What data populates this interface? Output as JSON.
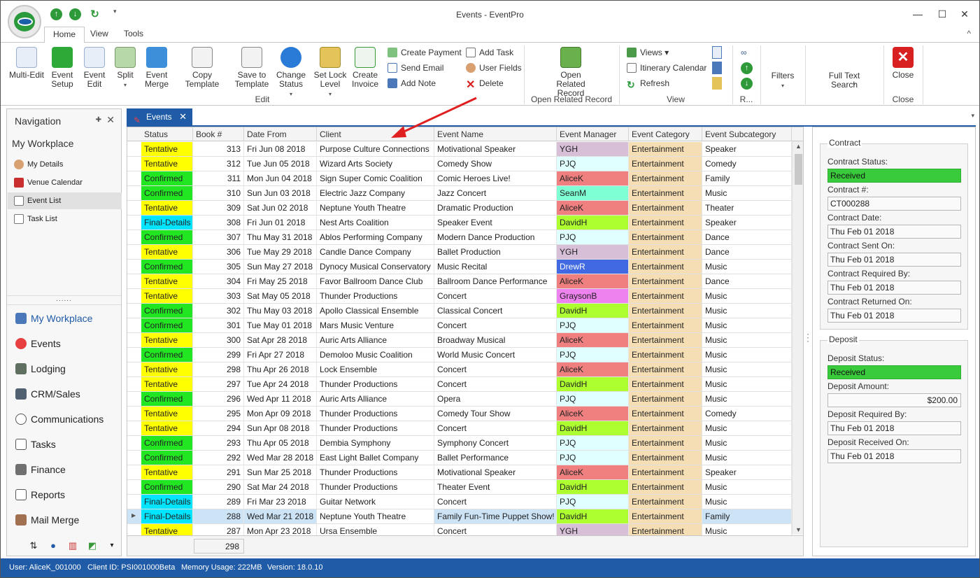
{
  "window": {
    "title": "Events - EventPro"
  },
  "ribbon": {
    "tabs": [
      "Home",
      "View",
      "Tools"
    ],
    "edit_group": {
      "buttons": [
        "Multi-Edit",
        "Event Setup",
        "Event Edit",
        "Split",
        "Event Merge",
        "Copy Template",
        "Save to Template",
        "Change Status",
        "Set Lock Level",
        "Create Invoice"
      ],
      "small": [
        "Create Payment",
        "Send Email",
        "Add Note",
        "Add Task",
        "User Fields",
        "Delete"
      ],
      "label": "Edit"
    },
    "open_related": {
      "button": "Open Related Record",
      "label": "Open Related Record"
    },
    "view_group": {
      "small": [
        "Views",
        "Itinerary Calendar",
        "Refresh"
      ],
      "label": "View"
    },
    "r_label": "R...",
    "filters": "Filters",
    "full_text_search": "Full Text Search",
    "close": {
      "button": "Close",
      "label": "Close"
    }
  },
  "navigation": {
    "title": "Navigation",
    "workplace": "My Workplace",
    "sub_items": [
      "My Details",
      "Venue Calendar",
      "Event List",
      "Task List"
    ],
    "grip": "......",
    "main_items": [
      "My Workplace",
      "Events",
      "Lodging",
      "CRM/Sales",
      "Communications",
      "Tasks",
      "Finance",
      "Reports",
      "Mail Merge"
    ]
  },
  "doc_tab": {
    "label": "Events"
  },
  "grid": {
    "columns": [
      "Status",
      "Book #",
      "Date From",
      "Client",
      "Event Name",
      "Event Manager",
      "Event Category",
      "Event Subcategory"
    ],
    "rows": [
      [
        "Tentative",
        "313",
        "Fri Jun 08 2018",
        "Purpose Culture Connections",
        "Motivational Speaker",
        "YGH",
        "Entertainment",
        "Speaker"
      ],
      [
        "Tentative",
        "312",
        "Tue Jun 05 2018",
        "Wizard Arts Society",
        "Comedy Show",
        "PJQ",
        "Entertainment",
        "Comedy"
      ],
      [
        "Confirmed",
        "311",
        "Mon Jun 04 2018",
        "Sign Super Comic Coalition",
        "Comic Heroes Live!",
        "AliceK",
        "Entertainment",
        "Family"
      ],
      [
        "Confirmed",
        "310",
        "Sun Jun 03 2018",
        "Electric Jazz Company",
        "Jazz Concert",
        "SeanM",
        "Entertainment",
        "Music"
      ],
      [
        "Tentative",
        "309",
        "Sat Jun 02 2018",
        "Neptune Youth Theatre",
        "Dramatic Production",
        "AliceK",
        "Entertainment",
        "Theater"
      ],
      [
        "Final-Details",
        "308",
        "Fri Jun 01 2018",
        "Nest Arts Coalition",
        "Speaker Event",
        "DavidH",
        "Entertainment",
        "Speaker"
      ],
      [
        "Confirmed",
        "307",
        "Thu May 31 2018",
        "Ablos Performing Company",
        "Modern Dance Production",
        "PJQ",
        "Entertainment",
        "Dance"
      ],
      [
        "Tentative",
        "306",
        "Tue May 29 2018",
        "Candle Dance Company",
        "Ballet Production",
        "YGH",
        "Entertainment",
        "Dance"
      ],
      [
        "Confirmed",
        "305",
        "Sun May 27 2018",
        "Dynocy Musical Conservatory",
        "Music Recital",
        "DrewR",
        "Entertainment",
        "Music"
      ],
      [
        "Tentative",
        "304",
        "Fri May 25 2018",
        "Favor Ballroom Dance Club",
        "Ballroom Dance Performance",
        "AliceK",
        "Entertainment",
        "Dance"
      ],
      [
        "Tentative",
        "303",
        "Sat May 05 2018",
        "Thunder Productions",
        "Concert",
        "GraysonB",
        "Entertainment",
        "Music"
      ],
      [
        "Confirmed",
        "302",
        "Thu May 03 2018",
        "Apollo Classical Ensemble",
        "Classical Concert",
        "DavidH",
        "Entertainment",
        "Music"
      ],
      [
        "Confirmed",
        "301",
        "Tue May 01 2018",
        "Mars Music Venture",
        "Concert",
        "PJQ",
        "Entertainment",
        "Music"
      ],
      [
        "Tentative",
        "300",
        "Sat Apr 28 2018",
        "Auric Arts Alliance",
        "Broadway Musical",
        "AliceK",
        "Entertainment",
        "Music"
      ],
      [
        "Confirmed",
        "299",
        "Fri Apr 27 2018",
        "Demoloo Music Coalition",
        "World Music Concert",
        "PJQ",
        "Entertainment",
        "Music"
      ],
      [
        "Tentative",
        "298",
        "Thu Apr 26 2018",
        "Lock Ensemble",
        "Concert",
        "AliceK",
        "Entertainment",
        "Music"
      ],
      [
        "Tentative",
        "297",
        "Tue Apr 24 2018",
        "Thunder Productions",
        "Concert",
        "DavidH",
        "Entertainment",
        "Music"
      ],
      [
        "Confirmed",
        "296",
        "Wed Apr 11 2018",
        "Auric Arts Alliance",
        "Opera",
        "PJQ",
        "Entertainment",
        "Music"
      ],
      [
        "Tentative",
        "295",
        "Mon Apr 09 2018",
        "Thunder Productions",
        "Comedy Tour Show",
        "AliceK",
        "Entertainment",
        "Comedy"
      ],
      [
        "Tentative",
        "294",
        "Sun Apr 08 2018",
        "Thunder Productions",
        "Concert",
        "DavidH",
        "Entertainment",
        "Music"
      ],
      [
        "Confirmed",
        "293",
        "Thu Apr 05 2018",
        "Dembia Symphony",
        "Symphony Concert",
        "PJQ",
        "Entertainment",
        "Music"
      ],
      [
        "Confirmed",
        "292",
        "Wed Mar 28 2018",
        "East Light Ballet Company",
        "Ballet Performance",
        "PJQ",
        "Entertainment",
        "Music"
      ],
      [
        "Tentative",
        "291",
        "Sun Mar 25 2018",
        "Thunder Productions",
        "Motivational Speaker",
        "AliceK",
        "Entertainment",
        "Speaker"
      ],
      [
        "Confirmed",
        "290",
        "Sat Mar 24 2018",
        "Thunder Productions",
        "Theater Event",
        "DavidH",
        "Entertainment",
        "Music"
      ],
      [
        "Final-Details",
        "289",
        "Fri Mar 23 2018",
        "Guitar Network",
        "Concert",
        "PJQ",
        "Entertainment",
        "Music"
      ],
      [
        "Final-Details",
        "288",
        "Wed Mar 21 2018",
        "Neptune Youth Theatre",
        "Family Fun-Time Puppet Show!",
        "DavidH",
        "Entertainment",
        "Family"
      ],
      [
        "Tentative",
        "287",
        "Mon Apr 23 2018",
        "Ursa Ensemble",
        "Concert",
        "YGH",
        "Entertainment",
        "Music"
      ]
    ],
    "selected_book": "288",
    "footer_count": "298"
  },
  "colors": {
    "status": {
      "Tentative": "#ffff00",
      "Confirmed": "#22e622",
      "Final-Details": "#00e5ff"
    },
    "manager": {
      "YGH": "#d8bfd8",
      "PJQ": "#e0ffff",
      "AliceK": "#f08080",
      "SeanM": "#7fffd4",
      "DavidH": "#adff2f",
      "DrewR": "#4169e1",
      "GraysonB": "#ee82ee"
    },
    "category": "#f5deb3"
  },
  "contract": {
    "title": "Contract",
    "status_label": "Contract Status:",
    "status": "Received",
    "number_label": "Contract #:",
    "number": "CT000288",
    "date_label": "Contract Date:",
    "date": "Thu Feb 01 2018",
    "sent_label": "Contract Sent On:",
    "sent": "Thu Feb 01 2018",
    "required_label": "Contract Required By:",
    "required": "Thu Feb 01 2018",
    "returned_label": "Contract Returned On:",
    "returned": "Thu Feb 01 2018"
  },
  "deposit": {
    "title": "Deposit",
    "status_label": "Deposit Status:",
    "status": "Received",
    "amount_label": "Deposit Amount:",
    "amount": "$200.00",
    "required_label": "Deposit Required By:",
    "required": "Thu Feb 01 2018",
    "received_label": "Deposit Received On:",
    "received": "Thu Feb 01 2018"
  },
  "statusbar": {
    "user": "User: AliceK_001000",
    "client": "Client ID: PSI001000Beta",
    "memory": "Memory Usage: 222MB",
    "version": "Version: 18.0.10"
  }
}
